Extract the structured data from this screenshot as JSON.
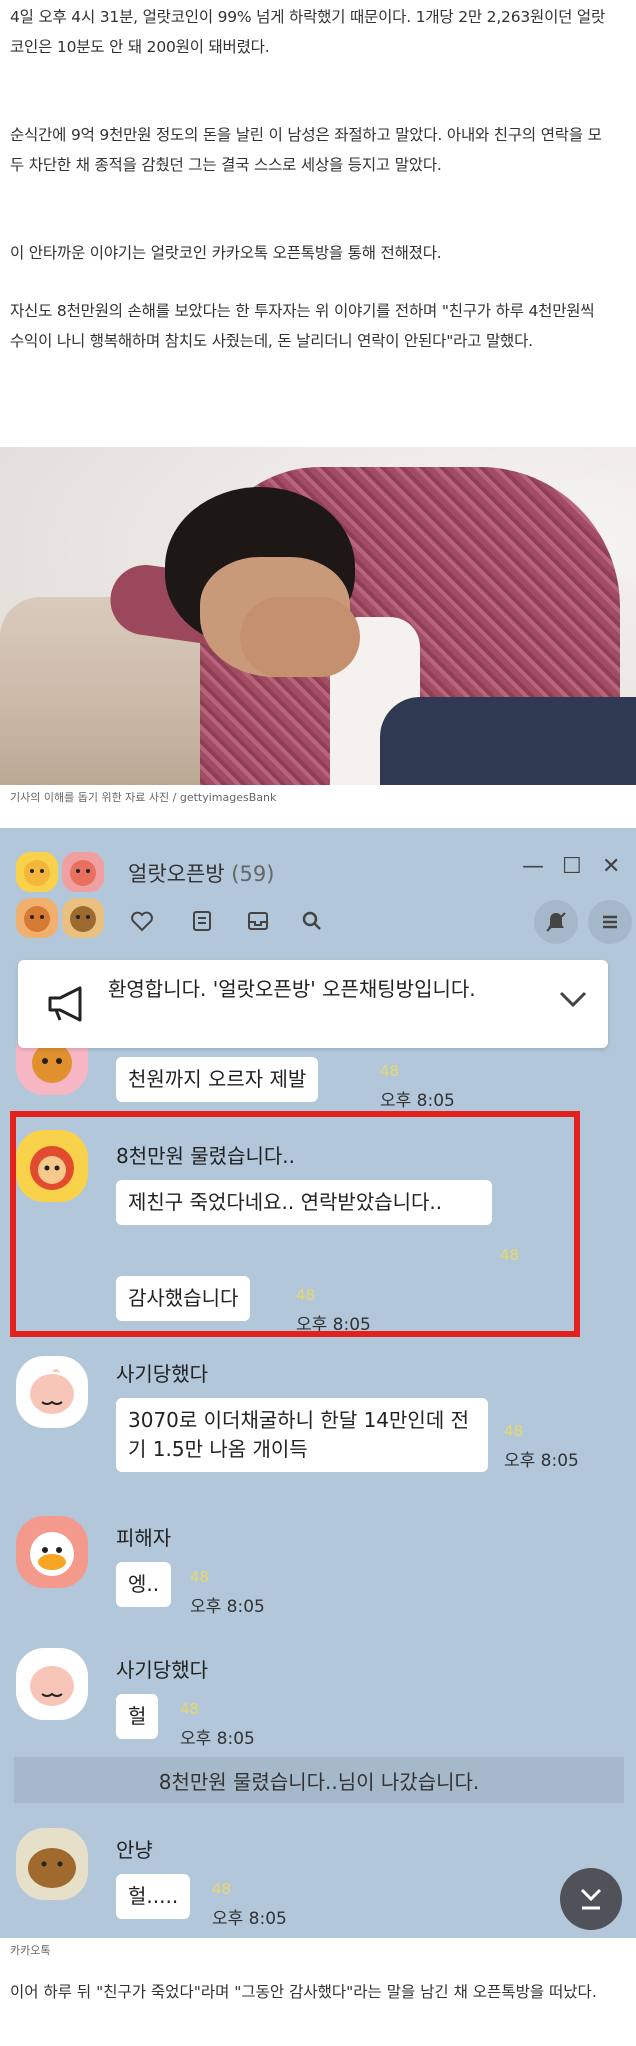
{
  "article": {
    "p1": "4일 오후 4시 31분, 얼랏코인이 99% 넘게 하락했기 때문이다. 1개당 2만 2,263원이던 얼랏코인은 10분도 안 돼 200원이 돼버렸다.",
    "p2": "순식간에 9억 9천만원 정도의 돈을 날린 이 남성은 좌절하고 말았다. 아내와 친구의 연락을 모두 차단한 채 종적을 감췄던 그는 결국 스스로 세상을 등지고 말았다.",
    "p3": "이 안타까운 이야기는 얼랏코인 카카오톡 오픈톡방을 통해 전해졌다.",
    "p4": "자신도 8천만원의 손해를 보았다는 한 투자자는 위 이야기를 전하며 \"친구가 하루 4천만원씩 수익이 나니 행복해하며 참치도 사줬는데, 돈 날리더니 연락이 안된다\"라고 말했다.",
    "photo_caption": "기사의 이해를 돕기 위한 자료 사진 / gettyimagesBank",
    "chat_source": "카카오톡",
    "final": "이어 하루 뒤 \"친구가 죽었다\"라며 \"그동안 감사했다\"라는 말을 남긴 채 오픈톡방을 떠났다."
  },
  "chat": {
    "title": "얼랏오픈방",
    "member_count": "(59)",
    "window_controls": [
      "—",
      "☐",
      "✕"
    ],
    "notice": "환영합니다. '얼랏오픈방' 오픈채팅방입니다.",
    "messages": [
      {
        "sender": "",
        "text": "천원까지 오르자 제발",
        "count": "48",
        "time": "오후 8:05"
      },
      {
        "sender": "8천만원 물렸습니다..",
        "text": "제친구 죽었다네요.. 연락받았습니다..",
        "count": "48"
      },
      {
        "sender": "",
        "text": "감사했습니다",
        "count": "48",
        "time": "오후 8:05"
      },
      {
        "sender": "사기당했다",
        "text": "3070로 이더채굴하니 한달 14만인데 전기 1.5만 나옴 개이득",
        "count": "48",
        "time": "오후 8:05"
      },
      {
        "sender": "피해자",
        "text": "엥..",
        "count": "48",
        "time": "오후 8:05"
      },
      {
        "sender": "사기당했다",
        "text": "헐",
        "count": "48",
        "time": "오후 8:05"
      },
      {
        "sender": "안냥",
        "text": "헐.....",
        "count": "48",
        "time": "오후 8:05"
      }
    ],
    "system_message": "8천만원 물렸습니다..님이 나갔습니다."
  }
}
